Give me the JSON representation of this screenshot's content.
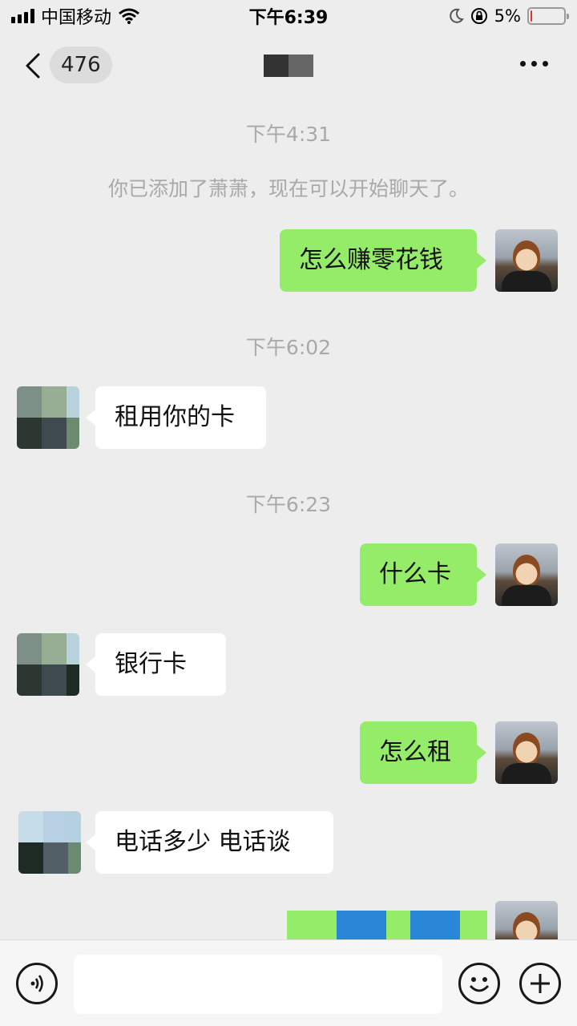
{
  "status_bar": {
    "carrier": "中国移动",
    "time": "下午6:39",
    "battery_percent": "5%"
  },
  "nav": {
    "unread_count": "476",
    "title_obscured": true
  },
  "chat": {
    "messages": [
      {
        "type": "timestamp",
        "text": "下午4:31"
      },
      {
        "type": "system",
        "text": "你已添加了萧萧，现在可以开始聊天了。"
      },
      {
        "type": "sent",
        "text": "怎么赚零花钱"
      },
      {
        "type": "timestamp",
        "text": "下午6:02"
      },
      {
        "type": "received",
        "text": "租用你的卡"
      },
      {
        "type": "timestamp",
        "text": "下午6:23"
      },
      {
        "type": "sent",
        "text": "什么卡"
      },
      {
        "type": "received",
        "text": "银行卡"
      },
      {
        "type": "sent",
        "text": "怎么租"
      },
      {
        "type": "received",
        "text": "电话多少  电话谈"
      }
    ]
  },
  "colors": {
    "sent_bubble": "#95ec69",
    "received_bubble": "#ffffff",
    "background": "#ededed"
  },
  "icons": {
    "back": "chevron-left-icon",
    "more": "more-dots-icon",
    "voice": "voice-icon",
    "emoji": "emoji-icon",
    "plus": "plus-icon"
  }
}
